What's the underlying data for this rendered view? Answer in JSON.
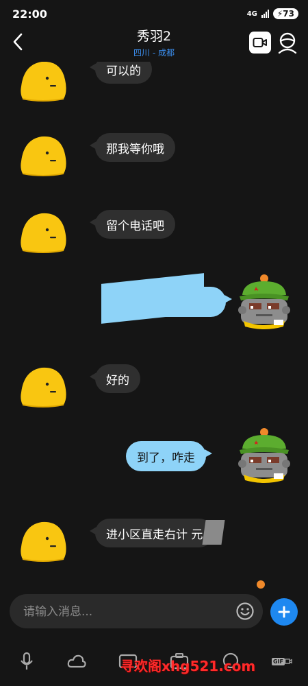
{
  "status_bar": {
    "time": "22:00",
    "network": "4G",
    "battery": "73"
  },
  "header": {
    "title": "秀羽2",
    "subtitle": "四川 - 成都"
  },
  "messages": [
    {
      "side": "left",
      "text": "可以的"
    },
    {
      "side": "left",
      "text": "那我等你哦"
    },
    {
      "side": "left",
      "text": "留个电话吧"
    },
    {
      "side": "right",
      "text": "",
      "redacted": true
    },
    {
      "side": "left",
      "text": "好的"
    },
    {
      "side": "right",
      "text": "到了，咋走"
    },
    {
      "side": "left",
      "text": "进小区直走右计 元",
      "partially_redacted": true
    }
  ],
  "input": {
    "placeholder": "请输入消息..."
  },
  "toolbar": {
    "items": [
      "mic-icon",
      "cloud-icon",
      "image-icon",
      "camera-icon",
      "voice-icon",
      "gif-icon"
    ],
    "gif_label": "GIF"
  },
  "watermark": "寻欢阁xhg521.com",
  "colors": {
    "background": "#151515",
    "bubble_left": "#2f2f2f",
    "bubble_right": "#8ed3f8",
    "accent": "#1e88f0",
    "subtitle": "#3b8ff0"
  }
}
